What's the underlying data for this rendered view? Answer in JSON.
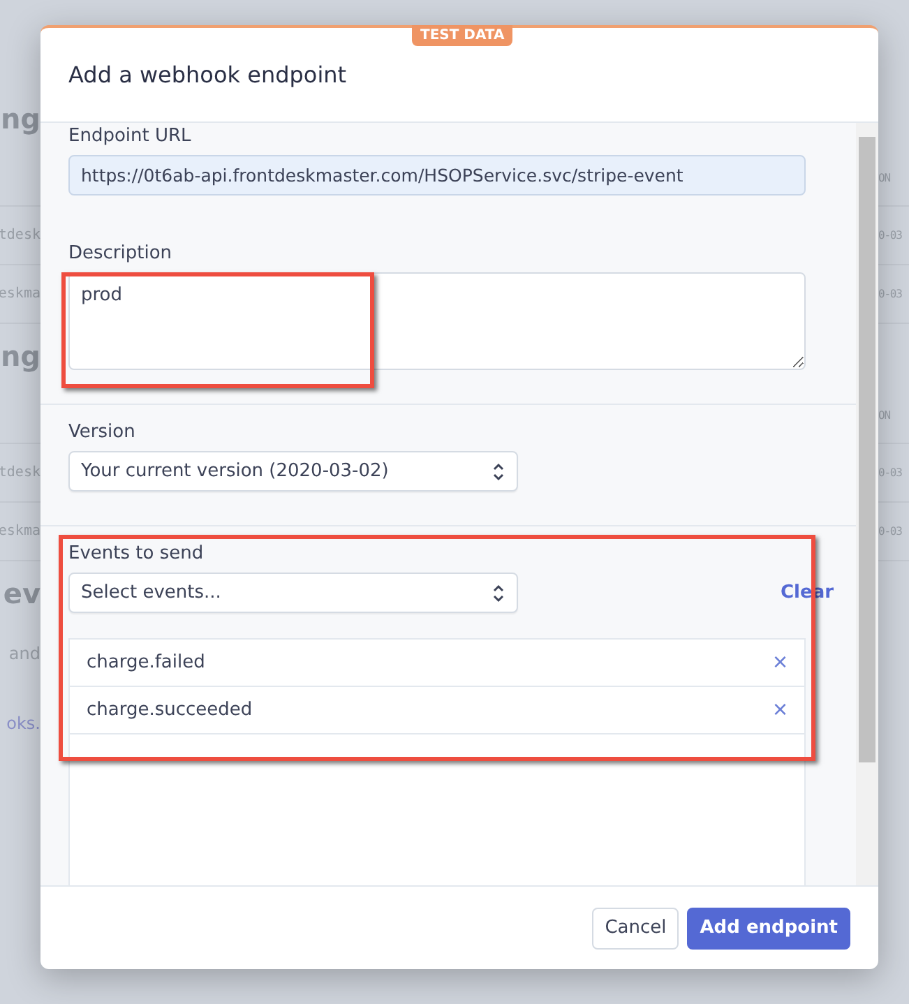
{
  "background": {
    "rows": [
      {
        "kind": "heading",
        "left": "ng"
      },
      {
        "kind": "header",
        "right": "ON"
      },
      {
        "kind": "row",
        "left": "tdesk",
        "right": "0-03"
      },
      {
        "kind": "row",
        "left": "eskma",
        "right": "0-03"
      },
      {
        "kind": "heading",
        "left": "ng"
      },
      {
        "kind": "header",
        "right": "ON"
      },
      {
        "kind": "row",
        "left": "tdesk",
        "right": "0-03"
      },
      {
        "kind": "row",
        "left": "eskma",
        "right": "0-03"
      },
      {
        "kind": "heading",
        "left": "ev"
      },
      {
        "kind": "sub",
        "left": "and"
      },
      {
        "kind": "link",
        "left": "oks."
      }
    ]
  },
  "modal": {
    "badge": "TEST DATA",
    "title": "Add a webhook endpoint",
    "endpoint_url": {
      "label": "Endpoint URL",
      "value": "https://0t6ab-api.frontdeskmaster.com/HSOPService.svc/stripe-event"
    },
    "description": {
      "label": "Description",
      "value": "prod",
      "highlighted": true
    },
    "version": {
      "label": "Version",
      "value": "Your current version (2020-03-02)"
    },
    "events": {
      "label": "Events to send",
      "placeholder": "Select events...",
      "clear": "Clear",
      "highlighted": true,
      "items": [
        {
          "name": "charge.failed",
          "remove": "×"
        },
        {
          "name": "charge.succeeded",
          "remove": "×"
        }
      ]
    },
    "buttons": [
      {
        "label": "Cancel",
        "kind": "secondary"
      },
      {
        "label": "Add endpoint",
        "kind": "primary"
      }
    ]
  }
}
